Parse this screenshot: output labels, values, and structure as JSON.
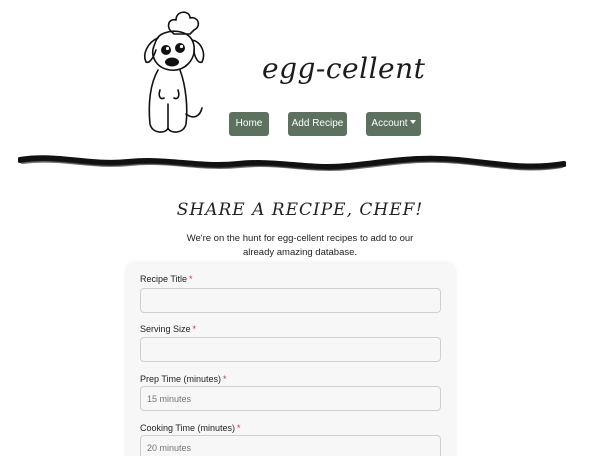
{
  "brand": {
    "name": "egg-cellent",
    "logo_icon": "chef-dog-icon"
  },
  "nav": {
    "home": "Home",
    "add_recipe": "Add Recipe",
    "account": "Account",
    "account_icon": "caret-down-icon",
    "button_color": "#5c725e"
  },
  "page": {
    "title": "SHARE A RECIPE, CHEF!",
    "intro": "We're on the hunt for egg-cellent recipes to add to our already amazing database."
  },
  "form": {
    "required_marker": "*",
    "fields": [
      {
        "label": "Recipe Title",
        "value": "",
        "placeholder": ""
      },
      {
        "label": "Serving Size",
        "value": "",
        "placeholder": ""
      },
      {
        "label": "Prep Time (minutes)",
        "value": "",
        "placeholder": "15 minutes"
      },
      {
        "label": "Cooking Time (minutes)",
        "value": "",
        "placeholder": "20 minutes"
      }
    ]
  },
  "colors": {
    "accent": "#5c725e",
    "required": "#d0323c",
    "card_bg": "#f7f7f7"
  }
}
